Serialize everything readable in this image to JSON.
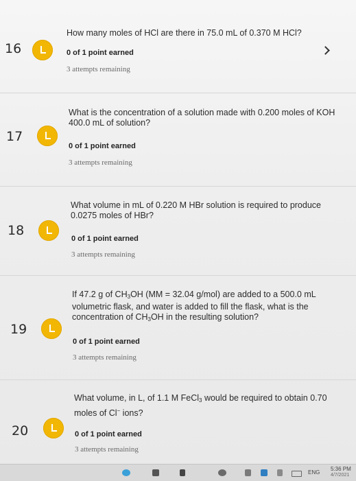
{
  "questions": [
    {
      "number": "16",
      "status_icon": "late-check-icon",
      "text_html": "How many moles of HCl are there in 75.0 mL of 0.370 M HCl?",
      "points": "0 of 1 point earned",
      "attempts": "3 attempts remaining"
    },
    {
      "number": "17",
      "status_icon": "late-check-icon",
      "text_html": "What is the concentration of a solution made with 0.200 moles of KOH 400.0 mL of solution?",
      "points": "0 of 1 point earned",
      "attempts": "3 attempts remaining"
    },
    {
      "number": "18",
      "status_icon": "late-check-icon",
      "text_html": "What volume in mL of 0.220 M HBr solution is required to produce 0.0275 moles of HBr?",
      "points": "0 of 1 point earned",
      "attempts": "3 attempts remaining"
    },
    {
      "number": "19",
      "status_icon": "late-check-icon",
      "text_html": "If 47.2 g of CH<sub>3</sub>OH (MM = 32.04 g/mol) are added to a 500.0 mL volumetric flask, and water is added to fill the flask, what is the concentration of CH<sub>3</sub>OH in the resulting solution?",
      "points": "0 of 1 point earned",
      "attempts": "3 attempts remaining"
    },
    {
      "number": "20",
      "status_icon": "late-check-icon",
      "text_html": "What volume, in L, of 1.1 M FeCl<sub>3</sub> would be required to obtain 0.70 moles of Cl<sup>−</sup> ions?",
      "points": "0 of 1 point earned",
      "attempts": "3 attempts remaining"
    }
  ],
  "nav": {
    "next_icon": "chevron-right-icon"
  },
  "taskbar": {
    "language": "ENG",
    "time": "5:36 PM",
    "date": "4/7/2021"
  },
  "colors": {
    "badge": "#f2b705",
    "background": "#efefef"
  }
}
